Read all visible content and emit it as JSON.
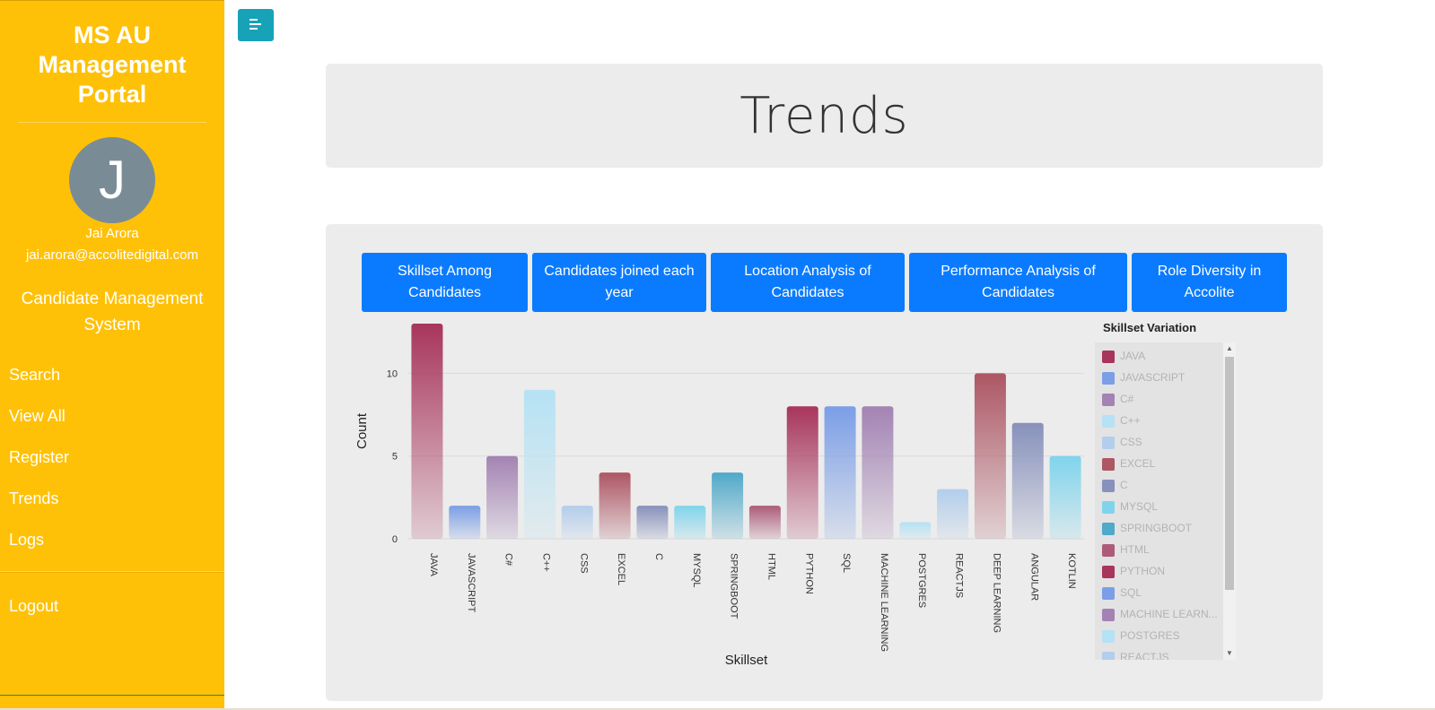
{
  "sidebar": {
    "brand": "MS AU Management Portal",
    "avatar_initial": "J",
    "user_name": "Jai Arora",
    "user_email": "jai.arora@accolitedigital.com",
    "section_title": "Candidate Management System",
    "nav": [
      "Search",
      "View All",
      "Register",
      "Trends",
      "Logs"
    ],
    "logout": "Logout"
  },
  "header": {
    "title": "Trends"
  },
  "tabs": [
    "Skillset Among Candidates",
    "Candidates joined each year",
    "Location Analysis of Candidates",
    "Performance Analysis of Candidates",
    "Role Diversity in Accolite"
  ],
  "legend": {
    "title": "Skillset Variation",
    "visible_labels": [
      "JAVA",
      "JAVASCRIPT",
      "C#",
      "C++",
      "CSS",
      "EXCEL",
      "C",
      "MYSQL",
      "SPRINGBOOT",
      "HTML",
      "PYTHON",
      "SQL",
      "MACHINE LEARN...",
      "POSTGRES",
      "REACTJS"
    ]
  },
  "chart_data": {
    "type": "bar",
    "xlabel": "Skillset",
    "ylabel": "Count",
    "ylim": [
      0,
      13
    ],
    "yticks": [
      0,
      5,
      10
    ],
    "grid": true,
    "legend_position": "right",
    "categories": [
      "JAVA",
      "JAVASCRIPT",
      "C#",
      "C++",
      "CSS",
      "EXCEL",
      "C",
      "MYSQL",
      "SPRINGBOOT",
      "HTML",
      "PYTHON",
      "SQL",
      "MACHINE LEARNING",
      "POSTGRES",
      "REACTJS",
      "DEEP LEARNING",
      "ANGULAR",
      "KOTLIN"
    ],
    "values": [
      13,
      2,
      5,
      9,
      2,
      4,
      2,
      2,
      4,
      2,
      8,
      8,
      8,
      1,
      3,
      10,
      7,
      5
    ],
    "colors": [
      "#a8355c",
      "#7b9ee6",
      "#a383b3",
      "#b5e2f4",
      "#b3cdec",
      "#ad5664",
      "#8791bb",
      "#7fd4ec",
      "#4fa9c9",
      "#ac5c79",
      "#a8355c",
      "#7b9ee6",
      "#a383b3",
      "#b5e2f4",
      "#b3cdec",
      "#ad5664",
      "#8791bb",
      "#7fd4ec"
    ]
  }
}
